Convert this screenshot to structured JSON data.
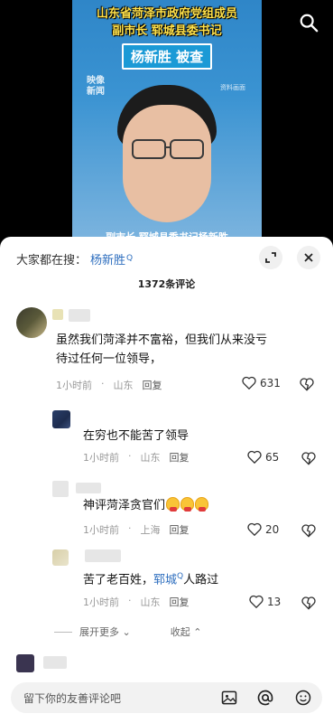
{
  "video": {
    "headline_line1": "山东省菏泽市政府党组成员",
    "headline_line2": "副市长  郓城县委书记",
    "tag": "杨新胜  被查",
    "logo_line1": "映像",
    "logo_line2": "新闻",
    "source_label": "资料画面",
    "caption_partial": "副市长  郓城县委书记杨新胜",
    "search_icon": "search-icon"
  },
  "sheet": {
    "search_prefix": "大家都在搜：",
    "search_keyword": "杨新胜",
    "count_label": "1372条评论",
    "expand_icon": "expand-icon",
    "close_icon": "close-icon"
  },
  "comments": [
    {
      "text_line1": "虽然我们菏泽并不富裕，但我们从来没亏",
      "text_line2": "待过任何一位领导，",
      "time": "1小时前",
      "location": "山东",
      "reply": "回复",
      "likes": "631"
    },
    {
      "text": "在穷也不能苦了领导",
      "time": "1小时前",
      "location": "山东",
      "reply": "回复",
      "likes": "65"
    },
    {
      "text": "神评菏泽贪官们",
      "time": "1小时前",
      "location": "上海",
      "reply": "回复",
      "likes": "20"
    },
    {
      "text_before": "苦了老百姓，",
      "text_keyword": "郓城",
      "text_after": "人路过",
      "time": "1小时前",
      "location": "山东",
      "reply": "回复",
      "likes": "13"
    }
  ],
  "more": {
    "expand_label": "展开更多",
    "collapse_label": "收起"
  },
  "input": {
    "placeholder": "留下你的友善评论吧"
  },
  "colors": {
    "accent_link": "#2f6fbf",
    "video_bg": "#3a93d2",
    "headline": "#ffe14a"
  }
}
